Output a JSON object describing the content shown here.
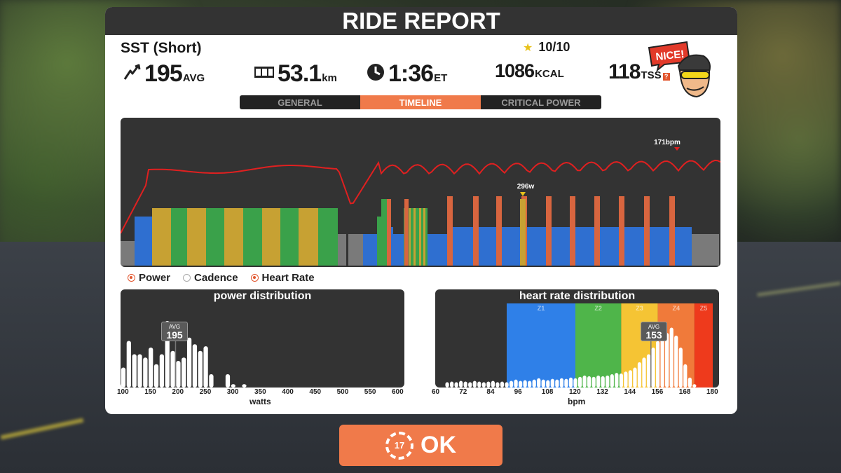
{
  "header": {
    "title": "RIDE REPORT"
  },
  "workout": {
    "name": "SST (Short)",
    "rating": "10/10",
    "star_color": "#e8c21b"
  },
  "stats": {
    "power": {
      "value": "195",
      "unit": "AVG",
      "icon": "lightning-icon"
    },
    "distance": {
      "value": "53.1",
      "unit": "km",
      "icon": "odometer-icon"
    },
    "time": {
      "value": "1:36",
      "unit": "ET",
      "icon": "clock-icon"
    },
    "calories": {
      "value": "1086",
      "unit": "KCAL"
    },
    "tss": {
      "value": "118",
      "unit": "TSS",
      "help": "?"
    }
  },
  "mascot": {
    "speech": "NICE!"
  },
  "tabs": [
    {
      "label": "GENERAL",
      "active": false
    },
    {
      "label": "TIMELINE",
      "active": true
    },
    {
      "label": "CRITICAL POWER",
      "active": false
    }
  ],
  "timeline": {
    "hr_peak_label": "171bpm",
    "power_peak_label": "296w",
    "colors": {
      "hr_line": "#e02020",
      "z1": "#7a7a7a",
      "z2": "#2f6fd0",
      "z3": "#3aa14a",
      "z4": "#c7a133",
      "z5": "#d8653f"
    }
  },
  "legend": [
    {
      "label": "Power",
      "on": true
    },
    {
      "label": "Cadence",
      "on": false
    },
    {
      "label": "Heart Rate",
      "on": true
    }
  ],
  "power_distribution": {
    "title": "power distribution",
    "avg_label": "AVG",
    "avg_value": "195",
    "ticks": [
      "100",
      "150",
      "200",
      "250",
      "300",
      "350",
      "400",
      "450",
      "500",
      "550",
      "600"
    ],
    "xlabel": "watts"
  },
  "hr_distribution": {
    "title": "heart rate distribution",
    "avg_label": "AVG",
    "avg_value": "153",
    "ticks": [
      "60",
      "72",
      "84",
      "96",
      "108",
      "120",
      "132",
      "144",
      "156",
      "168",
      "180"
    ],
    "xlabel": "bpm",
    "zones": [
      {
        "label": "Z1",
        "color": "#2f80e8"
      },
      {
        "label": "Z2",
        "color": "#4fb54a"
      },
      {
        "label": "Z3",
        "color": "#f5c434"
      },
      {
        "label": "Z4",
        "color": "#f07a3a"
      },
      {
        "label": "Z5",
        "color": "#ee3a1c"
      }
    ]
  },
  "ok_button": {
    "label": "OK",
    "countdown": "17"
  },
  "chart_data": [
    {
      "type": "bar",
      "title": "power distribution",
      "xlabel": "watts",
      "x": [
        100,
        110,
        120,
        130,
        140,
        150,
        160,
        170,
        180,
        190,
        200,
        210,
        220,
        230,
        240,
        250,
        260,
        270,
        280,
        290,
        300,
        310,
        320,
        330
      ],
      "values": [
        0.3,
        0.7,
        0.5,
        0.5,
        0.45,
        0.6,
        0.35,
        0.5,
        1.0,
        0.55,
        0.4,
        0.45,
        0.75,
        0.65,
        0.55,
        0.62,
        0.2,
        0,
        0,
        0.2,
        0.05,
        0,
        0.05,
        0
      ],
      "avg": 195,
      "xlim": [
        100,
        600
      ]
    },
    {
      "type": "bar",
      "title": "heart rate distribution",
      "xlabel": "bpm",
      "x": [
        64,
        66,
        68,
        70,
        72,
        74,
        76,
        78,
        80,
        82,
        84,
        86,
        88,
        90,
        92,
        94,
        96,
        98,
        100,
        102,
        104,
        106,
        108,
        110,
        112,
        114,
        116,
        118,
        120,
        122,
        124,
        126,
        128,
        130,
        132,
        134,
        136,
        138,
        140,
        142,
        144,
        146,
        148,
        150,
        152,
        154,
        156,
        158,
        160,
        162,
        164,
        166,
        168,
        170,
        172
      ],
      "values": [
        0.08,
        0.09,
        0.08,
        0.1,
        0.09,
        0.08,
        0.1,
        0.09,
        0.08,
        0.09,
        0.1,
        0.08,
        0.09,
        0.08,
        0.1,
        0.12,
        0.1,
        0.11,
        0.1,
        0.12,
        0.14,
        0.12,
        0.11,
        0.13,
        0.12,
        0.14,
        0.13,
        0.15,
        0.14,
        0.16,
        0.18,
        0.17,
        0.16,
        0.18,
        0.17,
        0.18,
        0.2,
        0.22,
        0.21,
        0.24,
        0.26,
        0.3,
        0.38,
        0.45,
        0.5,
        0.6,
        0.7,
        0.75,
        0.82,
        0.9,
        0.78,
        0.6,
        0.35,
        0.15,
        0.05
      ],
      "avg": 153,
      "xlim": [
        60,
        180
      ]
    }
  ]
}
